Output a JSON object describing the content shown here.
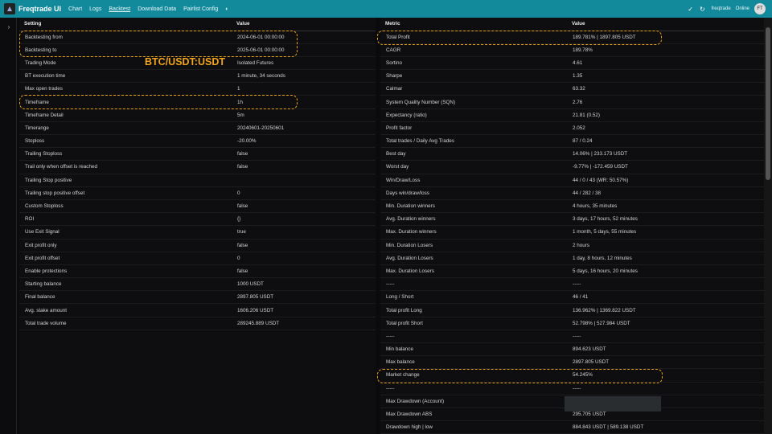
{
  "nav": {
    "brand": "Freqtrade UI",
    "links": [
      "Chart",
      "Logs",
      "Backtest",
      "Download Data",
      "Pairlist Config"
    ],
    "user": "freqtrade",
    "user_status": "Online",
    "avatar": "FT"
  },
  "pair_label": "BTC/USDT:USDT",
  "settings": {
    "headers": [
      "Setting",
      "Value"
    ],
    "rows": [
      [
        "Backtesting from",
        "2024-06-01 00:00:00"
      ],
      [
        "Backtesting to",
        "2025-06-01 00:00:00"
      ],
      [
        "Trading Mode",
        "Isolated Futures"
      ],
      [
        "BT execution time",
        "1 minute, 34 seconds"
      ],
      [
        "Max open trades",
        "1"
      ],
      [
        "Timeframe",
        "1h"
      ],
      [
        "Timeframe Detail",
        "5m"
      ],
      [
        "Timerange",
        "20240601-20250601"
      ],
      [
        "Stoploss",
        "-20.00%"
      ],
      [
        "Trailing Stoploss",
        "false"
      ],
      [
        "Trail only when offset is reached",
        "false"
      ],
      [
        "Trailing Stop positive",
        ""
      ],
      [
        "Trailing stop positive offset",
        "0"
      ],
      [
        "Custom Stoploss",
        "false"
      ],
      [
        "ROI",
        "{}"
      ],
      [
        "Use Exit Signal",
        "true"
      ],
      [
        "Exit profit only",
        "false"
      ],
      [
        "Exit profit offset",
        "0"
      ],
      [
        "Enable protections",
        "false"
      ],
      [
        "Starting balance",
        "1000 USDT"
      ],
      [
        "Final balance",
        "2897.805 USDT"
      ],
      [
        "Avg. stake amount",
        "1606.206 USDT"
      ],
      [
        "Total trade volume",
        "289245.889 USDT"
      ]
    ]
  },
  "metrics": {
    "headers": [
      "Metric",
      "Value"
    ],
    "rows": [
      [
        "Total Profit",
        "189.781% | 1897.805 USDT"
      ],
      [
        "CAGR",
        "189.78%"
      ],
      [
        "Sortino",
        "4.61"
      ],
      [
        "Sharpe",
        "1.35"
      ],
      [
        "Calmar",
        "63.32"
      ],
      [
        "System Quality Number (SQN)",
        "2.76"
      ],
      [
        "Expectancy (ratio)",
        "21.81 (0.52)"
      ],
      [
        "Profit factor",
        "2.052"
      ],
      [
        "Total trades / Daily Avg Trades",
        "87 / 0.24"
      ],
      [
        "Best day",
        "14.06% | 233.173 USDT"
      ],
      [
        "Worst day",
        "-9.77% | -172.459 USDT"
      ],
      [
        "Win/Draw/Loss",
        "44 / 0 / 43 (WR: 50.57%)"
      ],
      [
        "Days win/draw/loss",
        "44 / 282 / 38"
      ],
      [
        "Min. Duration winners",
        "4 hours, 35 minutes"
      ],
      [
        "Avg. Duration winners",
        "3 days, 17 hours, 52 minutes"
      ],
      [
        "Max. Duration winners",
        "1 month, 5 days, 55 minutes"
      ],
      [
        "Min. Duration Losers",
        "2 hours"
      ],
      [
        "Avg. Duration Losers",
        "1 day, 8 hours, 12 minutes"
      ],
      [
        "Max. Duration Losers",
        "5 days, 16 hours, 20 minutes"
      ],
      [
        "-----",
        "-----"
      ],
      [
        "Long / Short",
        "46 / 41"
      ],
      [
        "Total profit Long",
        "136.962% | 1369.822 USDT"
      ],
      [
        "Total profit Short",
        "52.798% | 527.984 USDT"
      ],
      [
        "-----",
        "-----"
      ],
      [
        "Min balance",
        "894.623 USDT"
      ],
      [
        "Max balance",
        "2897.805 USDT"
      ],
      [
        "Market change",
        "54.245%"
      ],
      [
        "-----",
        "-----"
      ],
      [
        "Max Drawdown (Account)",
        ""
      ],
      [
        "Max Drawdown ABS",
        "295.705 USDT"
      ],
      [
        "Drawdown high | low",
        "884.843 USDT | 589.138 USDT"
      ]
    ]
  },
  "colors": {
    "navbar": "#138a9c",
    "highlight": "#e8a21a"
  }
}
